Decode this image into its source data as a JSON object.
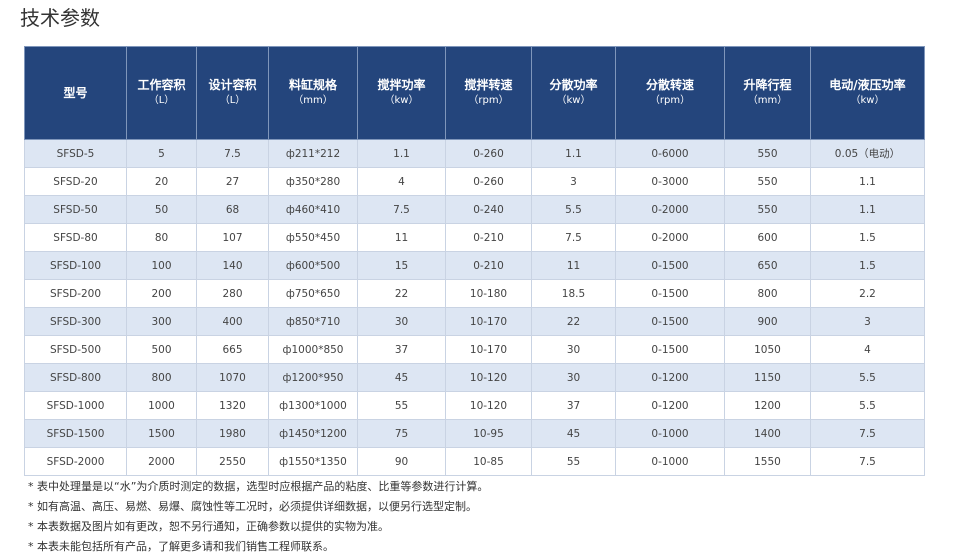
{
  "page_title": "技术参数",
  "table": {
    "headers": [
      {
        "label": "型号",
        "unit": ""
      },
      {
        "label": "工作容积",
        "unit": "（L）"
      },
      {
        "label": "设计容积",
        "unit": "（L）"
      },
      {
        "label": "料缸规格",
        "unit": "（mm）"
      },
      {
        "label": "搅拌功率",
        "unit": "（kw）"
      },
      {
        "label": "搅拌转速",
        "unit": "（rpm）"
      },
      {
        "label": "分散功率",
        "unit": "（kw）"
      },
      {
        "label": "分散转速",
        "unit": "（rpm）"
      },
      {
        "label": "升降行程",
        "unit": "（mm）"
      },
      {
        "label": "电动/液压功率",
        "unit": "（kw）"
      }
    ],
    "rows": [
      [
        "SFSD-5",
        "5",
        "7.5",
        "ф211*212",
        "1.1",
        "0-260",
        "1.1",
        "0-6000",
        "550",
        "0.05（电动）"
      ],
      [
        "SFSD-20",
        "20",
        "27",
        "ф350*280",
        "4",
        "0-260",
        "3",
        "0-3000",
        "550",
        "1.1"
      ],
      [
        "SFSD-50",
        "50",
        "68",
        "ф460*410",
        "7.5",
        "0-240",
        "5.5",
        "0-2000",
        "550",
        "1.1"
      ],
      [
        "SFSD-80",
        "80",
        "107",
        "ф550*450",
        "11",
        "0-210",
        "7.5",
        "0-2000",
        "600",
        "1.5"
      ],
      [
        "SFSD-100",
        "100",
        "140",
        "ф600*500",
        "15",
        "0-210",
        "11",
        "0-1500",
        "650",
        "1.5"
      ],
      [
        "SFSD-200",
        "200",
        "280",
        "ф750*650",
        "22",
        "10-180",
        "18.5",
        "0-1500",
        "800",
        "2.2"
      ],
      [
        "SFSD-300",
        "300",
        "400",
        "ф850*710",
        "30",
        "10-170",
        "22",
        "0-1500",
        "900",
        "3"
      ],
      [
        "SFSD-500",
        "500",
        "665",
        "ф1000*850",
        "37",
        "10-170",
        "30",
        "0-1500",
        "1050",
        "4"
      ],
      [
        "SFSD-800",
        "800",
        "1070",
        "ф1200*950",
        "45",
        "10-120",
        "30",
        "0-1200",
        "1150",
        "5.5"
      ],
      [
        "SFSD-1000",
        "1000",
        "1320",
        "ф1300*1000",
        "55",
        "10-120",
        "37",
        "0-1200",
        "1200",
        "5.5"
      ],
      [
        "SFSD-1500",
        "1500",
        "1980",
        "ф1450*1200",
        "75",
        "10-95",
        "45",
        "0-1000",
        "1400",
        "7.5"
      ],
      [
        "SFSD-2000",
        "2000",
        "2550",
        "ф1550*1350",
        "90",
        "10-85",
        "55",
        "0-1000",
        "1550",
        "7.5"
      ]
    ]
  },
  "notes": [
    "* 表中处理量是以“水”为介质时测定的数据，选型时应根据产品的粘度、比重等参数进行计算。",
    "* 如有高温、高压、易燃、易爆、腐蚀性等工况时，必须提供详细数据，以便另行选型定制。",
    "* 本表数据及图片如有更改，恕不另行通知，正确参数以提供的实物为准。",
    "* 本表未能包括所有产品，了解更多请和我们销售工程师联系。"
  ]
}
